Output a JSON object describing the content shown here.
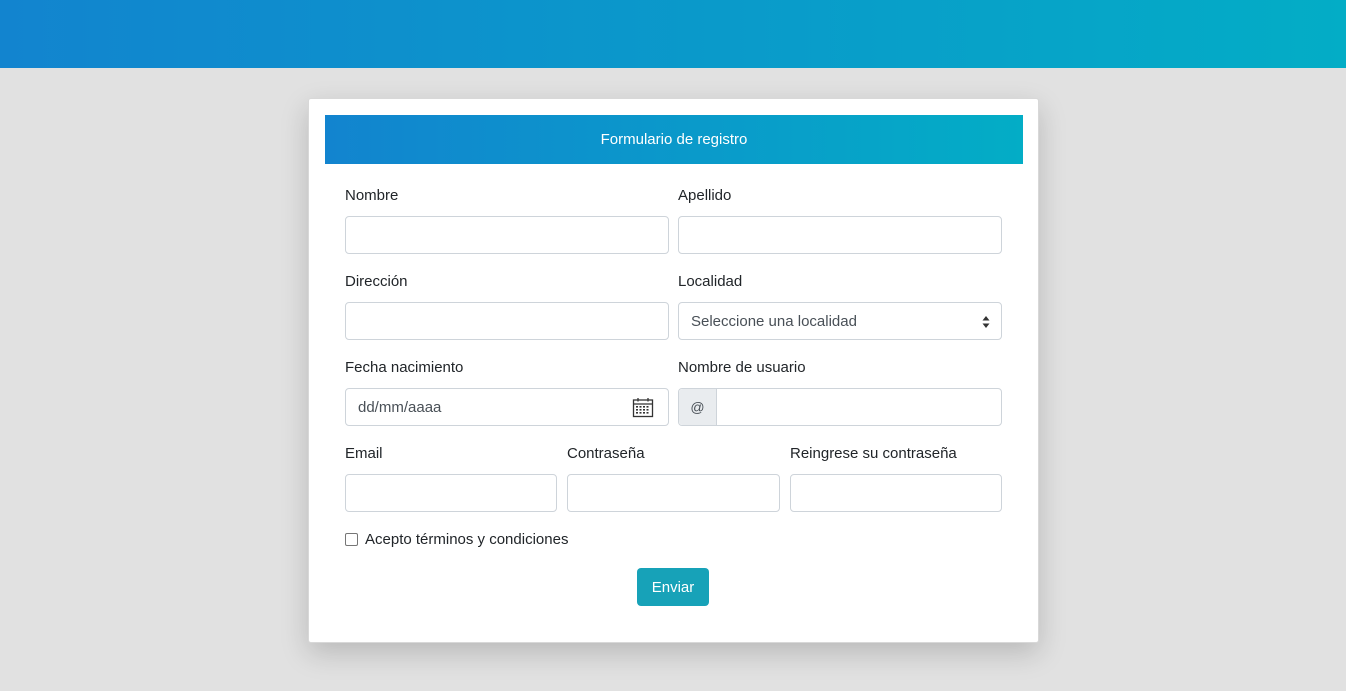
{
  "form": {
    "title": "Formulario de registro",
    "fields": {
      "nombre": {
        "label": "Nombre",
        "value": ""
      },
      "apellido": {
        "label": "Apellido",
        "value": ""
      },
      "direccion": {
        "label": "Dirección",
        "value": ""
      },
      "localidad": {
        "label": "Localidad",
        "selected": "Seleccione una localidad"
      },
      "fecha": {
        "label": "Fecha nacimiento",
        "placeholder": "dd/mm/aaaa"
      },
      "usuario": {
        "label": "Nombre de usuario",
        "addon": "@",
        "value": ""
      },
      "email": {
        "label": "Email",
        "value": ""
      },
      "password": {
        "label": "Contraseña",
        "value": ""
      },
      "password2": {
        "label": "Reingrese su contraseña",
        "value": ""
      }
    },
    "terms_label": "Acepto términos y condiciones",
    "submit_label": "Enviar"
  },
  "colors": {
    "gradient_start": "#1284cf",
    "gradient_end": "#03adc6",
    "button": "#17a2b8",
    "background": "#e1e1e1"
  },
  "icons": {
    "select": "sort-arrows-icon",
    "date": "calendar-icon"
  }
}
